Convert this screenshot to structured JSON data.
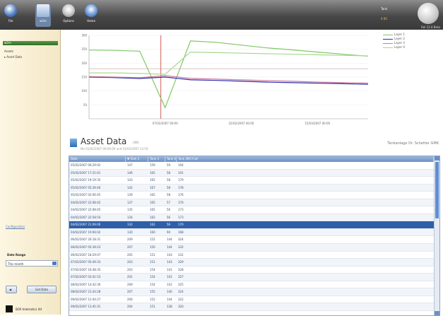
{
  "toolbar": {
    "buttons": [
      {
        "label": "File",
        "icon": "file-icon"
      },
      {
        "label": "w2m",
        "icon": "chart-icon",
        "active": true
      },
      {
        "label": "Options",
        "icon": "options-icon"
      },
      {
        "label": "Home",
        "icon": "home-icon"
      }
    ],
    "right_label": "Tank",
    "right_status": "6 85",
    "right_caption": "Rel 12.0 Beta"
  },
  "sidebar": {
    "header": "w2m",
    "assets_label": "Assets",
    "asset_item": "▸ Asset Data",
    "config_link": "Configuration",
    "date_range_label": "Date Range",
    "date_range_value": "This month",
    "back_label": "◀",
    "get_data_label": "Get Data",
    "footer": "BOX telematics ltd"
  },
  "chart_data": {
    "type": "line",
    "ylim": [
      0,
      300
    ],
    "yticks": [
      50,
      100,
      150,
      200,
      250,
      300
    ],
    "x_tick_labels": [
      "07/02/2007 00:00",
      "22/02/2007 00:00",
      "15/03/2007 00:00"
    ],
    "series": [
      {
        "name": "Layer 1",
        "color": "#7fc864",
        "values": [
          247,
          246,
          243,
          40,
          280,
          275,
          265,
          255,
          248,
          240,
          232,
          225
        ]
      },
      {
        "name": "Layer 2",
        "color": "#2f2aa8",
        "values": [
          150,
          148,
          145,
          150,
          140,
          138,
          135,
          132,
          130,
          128,
          126,
          124
        ]
      },
      {
        "name": "Layer 3",
        "color": "#c87aa0",
        "values": [
          152,
          150,
          148,
          155,
          145,
          143,
          140,
          137,
          135,
          132,
          130,
          128
        ]
      },
      {
        "name": "Layer 4",
        "color": "#a8d890",
        "values": [
          165,
          165,
          163,
          160,
          240,
          238,
          236,
          234,
          232,
          230,
          228,
          226
        ]
      }
    ],
    "reference_lines": [
      {
        "orientation": "vertical",
        "x_index": 3,
        "color": "#c83030"
      },
      {
        "orientation": "horizontal",
        "y": 180,
        "color": "#c8a0a0"
      }
    ]
  },
  "asset": {
    "title": "Asset Data",
    "count": "(49)",
    "subtitle": "Mo 01/02/2007 00:00:00 and 01/02/2007 23:59",
    "owner": "Tankanlage Dr. Schetter GMK"
  },
  "table": {
    "columns": [
      "Date",
      "▼ Tank 2",
      "Tank 3",
      "Tank 4",
      "Tank 3M3 Fuel"
    ],
    "rows": [
      [
        "05/02/2007 06:29:02",
        "147",
        "159",
        "59",
        "104"
      ],
      [
        "05/02/2007 17:21:01",
        "146",
        "165",
        "58",
        "101"
      ],
      [
        "05/02/2007 19:19:35",
        "143",
        "165",
        "58",
        "179"
      ],
      [
        "05/02/2007 05:39:40",
        "142",
        "167",
        "58",
        "178"
      ],
      [
        "05/02/2007 02:06:45",
        "139",
        "165",
        "58",
        "176"
      ],
      [
        "04/02/2007 22:08:42",
        "137",
        "165",
        "57",
        "176"
      ],
      [
        "04/02/2007 22:08:45",
        "135",
        "165",
        "56",
        "173"
      ],
      [
        "04/02/2007 22:58:54",
        "134",
        "162",
        "56",
        "173"
      ],
      [
        "04/02/2007 21:09:00",
        "132",
        "162",
        "56",
        "170"
      ],
      [
        "04/02/2007 19:06:02",
        "130",
        "160",
        "94",
        "168"
      ],
      [
        "06/02/2007 20:18:31",
        "209",
        "152",
        "144",
        "324"
      ],
      [
        "06/02/2007 05:39:23",
        "207",
        "150",
        "144",
        "332"
      ],
      [
        "06/02/2007 18:29:07",
        "205",
        "151",
        "143",
        "331"
      ],
      [
        "07/02/2007 05:49:33",
        "203",
        "151",
        "143",
        "329"
      ],
      [
        "07/02/2007 16:48:35",
        "203",
        "154",
        "141",
        "328"
      ],
      [
        "07/02/2007 03:41:53",
        "201",
        "154",
        "141",
        "327"
      ],
      [
        "08/02/2007 14:42:30",
        "209",
        "154",
        "141",
        "325"
      ],
      [
        "08/02/2007 21:43:28",
        "207",
        "155",
        "140",
        "324"
      ],
      [
        "09/02/2007 12:44:27",
        "206",
        "152",
        "144",
        "322"
      ],
      [
        "09/02/2007 13:45:31",
        "204",
        "151",
        "138",
        "320"
      ]
    ],
    "selected_row": 8
  }
}
